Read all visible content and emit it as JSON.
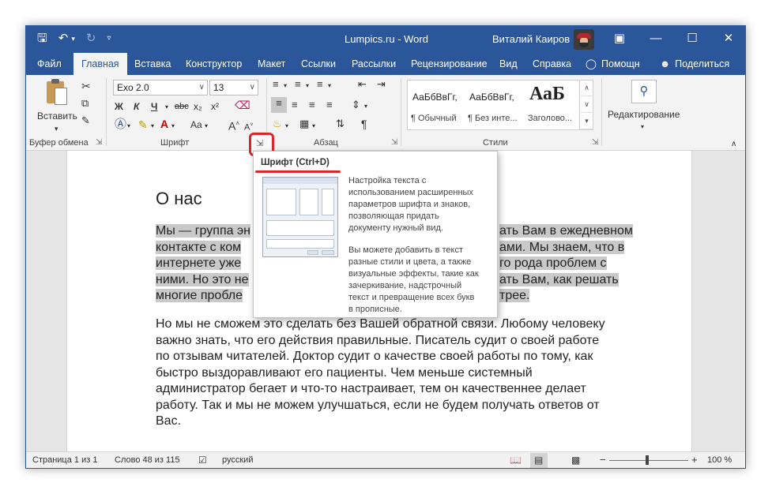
{
  "titlebar": {
    "title": "Lumpics.ru  -  Word",
    "user": "Виталий Каиров"
  },
  "tabs": [
    {
      "label": "Файл"
    },
    {
      "label": "Главная"
    },
    {
      "label": "Вставка"
    },
    {
      "label": "Конструктор"
    },
    {
      "label": "Макет"
    },
    {
      "label": "Ссылки"
    },
    {
      "label": "Рассылки"
    },
    {
      "label": "Рецензирование"
    },
    {
      "label": "Вид"
    },
    {
      "label": "Справка"
    },
    {
      "label": "Помощн"
    },
    {
      "label": "Поделиться"
    }
  ],
  "ribbon": {
    "clipboard": {
      "paste_label": "Вставить",
      "group_label": "Буфер обмена"
    },
    "font": {
      "font_name": "Exo 2.0",
      "font_size": "13",
      "bold": "Ж",
      "italic": "К",
      "underline": "Ч",
      "strike": "abc",
      "subscript": "x₂",
      "superscript": "x²",
      "change_case": "Aa",
      "group_label": "Шрифт"
    },
    "paragraph": {
      "group_label": "Абзац"
    },
    "styles": {
      "items": [
        {
          "preview": "АаБбВвГг,",
          "name": "¶ Обычный"
        },
        {
          "preview": "АаБбВвГг,",
          "name": "¶ Без инте..."
        },
        {
          "preview": "АаБ",
          "name": "Заголово..."
        }
      ],
      "group_label": "Стили"
    },
    "editing": {
      "label": "Редактирование"
    }
  },
  "tooltip": {
    "title": "Шрифт (Ctrl+D)",
    "lines_1": [
      "Настройка текста с",
      "использованием расширенных",
      "параметров шрифта и знаков,",
      "позволяющая придать",
      "документу нужный вид."
    ],
    "lines_2": [
      "Вы можете добавить в текст",
      "разные стили и цвета, а также",
      "визуальные эффекты, такие как",
      "зачеркивание, надстрочный",
      "текст и превращение всех букв",
      "в прописные."
    ]
  },
  "document": {
    "heading": "О нас",
    "para1_lines": [
      "Мы — группа эн",
      "контакте с ком",
      "интернете уже",
      "ними. Но это не",
      "многие пробле"
    ],
    "para1_right": [
      "ать Вам в ежедневном",
      "ами. Мы знаем, что в",
      "го рода проблем с",
      "ать Вам, как решать",
      "трее."
    ],
    "para2_lines": [
      "Но мы не сможем это сделать без Вашей обратной связи. Любому человеку",
      "важно знать, что его действия правильные. Писатель судит о своей работе",
      "по отзывам читателей. Доктор судит о качестве своей работы по тому, как",
      "быстро выздоравливают его пациенты. Чем меньше системный",
      "администратор бегает и что-то настраивает, тем он качественнее делает",
      "работу. Так и мы не можем улучшаться, если не будем получать ответов от",
      "Вас."
    ]
  },
  "status": {
    "page": "Страница 1 из 1",
    "words": "Слово 48 из 115",
    "language": "русский",
    "zoom_minus": "−",
    "zoom_plus": "+",
    "zoom": "100 %",
    "zoom_level_percent": 100
  },
  "colors": {
    "accent": "#2b579a",
    "highlight": "#d9272e",
    "selection": "#c9c9c9"
  }
}
